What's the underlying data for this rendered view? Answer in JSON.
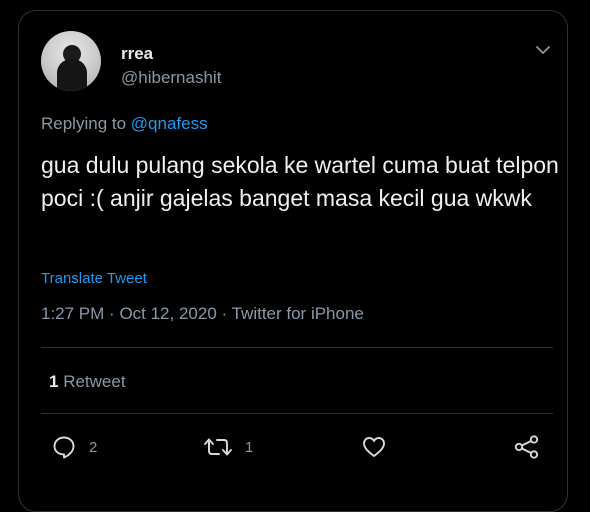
{
  "tweet": {
    "display_name": "rrea",
    "handle": "@hibernashit",
    "replying_prefix": "Replying to",
    "replying_to": "@qnafess",
    "text": "gua dulu pulang sekola ke wartel cuma buat telpon poci :( anjir gajelas banget masa kecil gua wkwk",
    "translate_label": "Translate Tweet",
    "time": "1:27 PM",
    "date": "Oct 12, 2020",
    "source": "Twitter for iPhone",
    "retweet_count": "1",
    "retweet_label": "Retweet"
  },
  "actions": {
    "reply_count": "2",
    "retweet_count": "1"
  },
  "icons": {
    "more": "chevron-down-icon",
    "reply": "reply-icon",
    "retweet": "retweet-icon",
    "like": "heart-icon",
    "share": "share-icon"
  },
  "colors": {
    "background": "#000000",
    "text": "#e7e9ea",
    "secondary": "#8b98a5",
    "link": "#1d9bf0",
    "border": "#2f3336"
  }
}
